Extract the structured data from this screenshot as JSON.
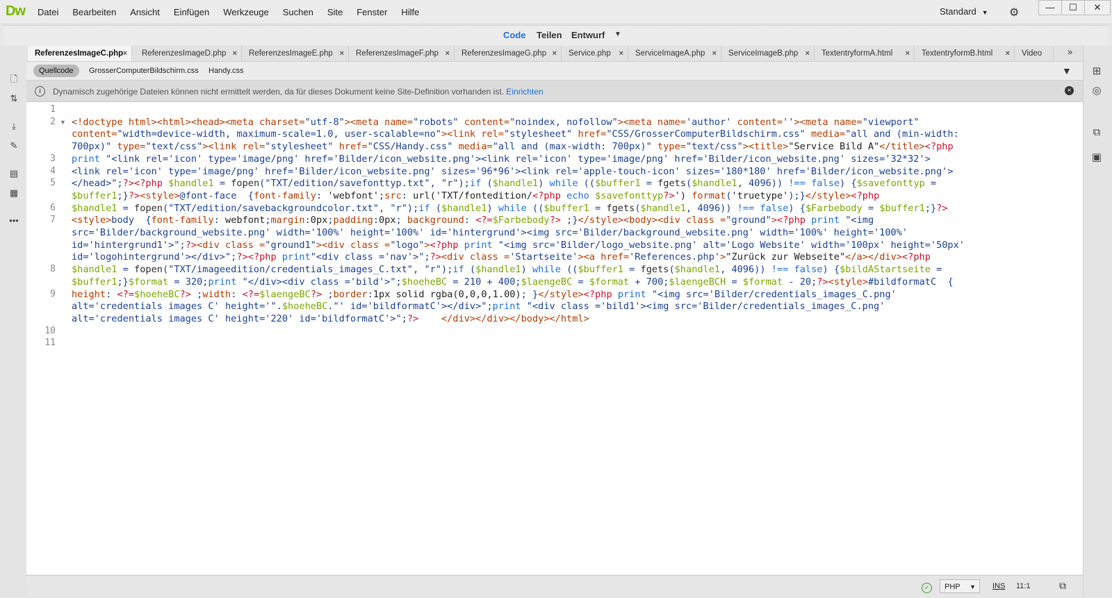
{
  "app": {
    "logo": "Dw"
  },
  "menu": [
    "Datei",
    "Bearbeiten",
    "Ansicht",
    "Einfügen",
    "Werkzeuge",
    "Suchen",
    "Site",
    "Fenster",
    "Hilfe"
  ],
  "workspace": {
    "label": "Standard"
  },
  "window_buttons": {
    "minimize": "—",
    "maximize": "☐",
    "close": "✕"
  },
  "views": {
    "code": "Code",
    "split": "Teilen",
    "design": "Entwurf"
  },
  "tabs": [
    {
      "label": "ReferenzesImageC.php",
      "active": true
    },
    {
      "label": "ReferenzesImageD.php"
    },
    {
      "label": "ReferenzesImageE.php"
    },
    {
      "label": "ReferenzesImageF.php"
    },
    {
      "label": "ReferenzesImageG.php"
    },
    {
      "label": "Service.php"
    },
    {
      "label": "ServiceImageA.php"
    },
    {
      "label": "ServiceImageB.php"
    },
    {
      "label": "TextentryformA.html"
    },
    {
      "label": "TextentryformB.html"
    },
    {
      "label": "Video"
    }
  ],
  "tab_close": "×",
  "related_files": {
    "source": "Quellcode",
    "files": [
      "GrosserComputerBildschirm.css",
      "Handy.css"
    ]
  },
  "info_bar": {
    "text": "Dynamisch zugehörige Dateien können nicht ermittelt werden, da für dieses Dokument keine Site-Definition vorhanden ist.",
    "link": "Einrichten"
  },
  "line_numbers": [
    "1",
    "2",
    "3",
    "4",
    "5",
    "6",
    "7",
    "8",
    "9",
    "10",
    "11"
  ],
  "status": {
    "language": "PHP",
    "mode": "INS",
    "position": "11:1"
  },
  "colors": {
    "logo": "#7ab800",
    "accent": "#1e6fd0",
    "tag": "#b03a00",
    "php": "#c8102e",
    "variable": "#7aa500"
  }
}
